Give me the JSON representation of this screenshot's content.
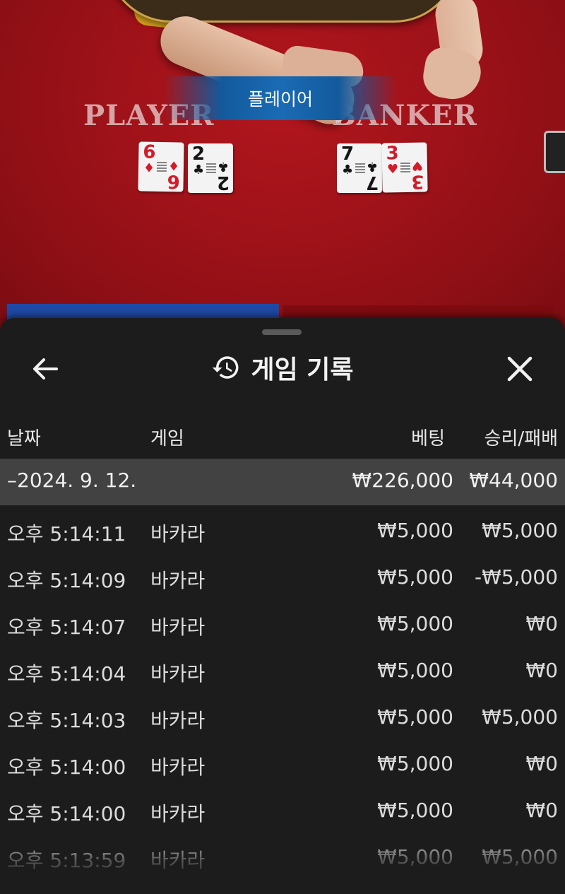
{
  "table": {
    "player_label": "PLAYER",
    "banker_label": "BANKER",
    "result_banner": "플레이어",
    "player_cards": [
      {
        "rank": "6",
        "suit": "♦",
        "color": "#d41b2a"
      },
      {
        "rank": "2",
        "suit": "♣",
        "color": "#151515"
      }
    ],
    "banker_cards": [
      {
        "rank": "7",
        "suit": "♣",
        "color": "#151515"
      },
      {
        "rank": "3",
        "suit": "♥",
        "color": "#d41b2a"
      }
    ]
  },
  "sheet": {
    "title": "게임 기록",
    "title_icon": "history-icon",
    "back_icon": "arrow-left-icon",
    "close_icon": "close-icon",
    "columns": {
      "date": "날짜",
      "game": "게임",
      "bet": "베팅",
      "win_loss": "승리/패배"
    },
    "summary": {
      "date": "–2024. 9. 12.",
      "bet": "₩226,000",
      "win_loss": "₩44,000"
    },
    "rows": [
      {
        "time": "오후 5:14:11",
        "game": "바카라",
        "bet": "₩5,000",
        "win_loss": "₩5,000"
      },
      {
        "time": "오후 5:14:09",
        "game": "바카라",
        "bet": "₩5,000",
        "win_loss": "-₩5,000"
      },
      {
        "time": "오후 5:14:07",
        "game": "바카라",
        "bet": "₩5,000",
        "win_loss": "₩0"
      },
      {
        "time": "오후 5:14:04",
        "game": "바카라",
        "bet": "₩5,000",
        "win_loss": "₩0"
      },
      {
        "time": "오후 5:14:03",
        "game": "바카라",
        "bet": "₩5,000",
        "win_loss": "₩5,000"
      },
      {
        "time": "오후 5:14:00",
        "game": "바카라",
        "bet": "₩5,000",
        "win_loss": "₩0"
      },
      {
        "time": "오후 5:14:00",
        "game": "바카라",
        "bet": "₩5,000",
        "win_loss": "₩0"
      },
      {
        "time": "오후 5:13:59",
        "game": "바카라",
        "bet": "₩5,000",
        "win_loss": "₩5,000"
      }
    ]
  },
  "colors": {
    "table_felt": "#a01219",
    "player_blue": "#1e49a6",
    "banner_blue": "#1a6bb5",
    "sheet_bg": "#1c1c1c",
    "summary_bg": "#424242"
  }
}
